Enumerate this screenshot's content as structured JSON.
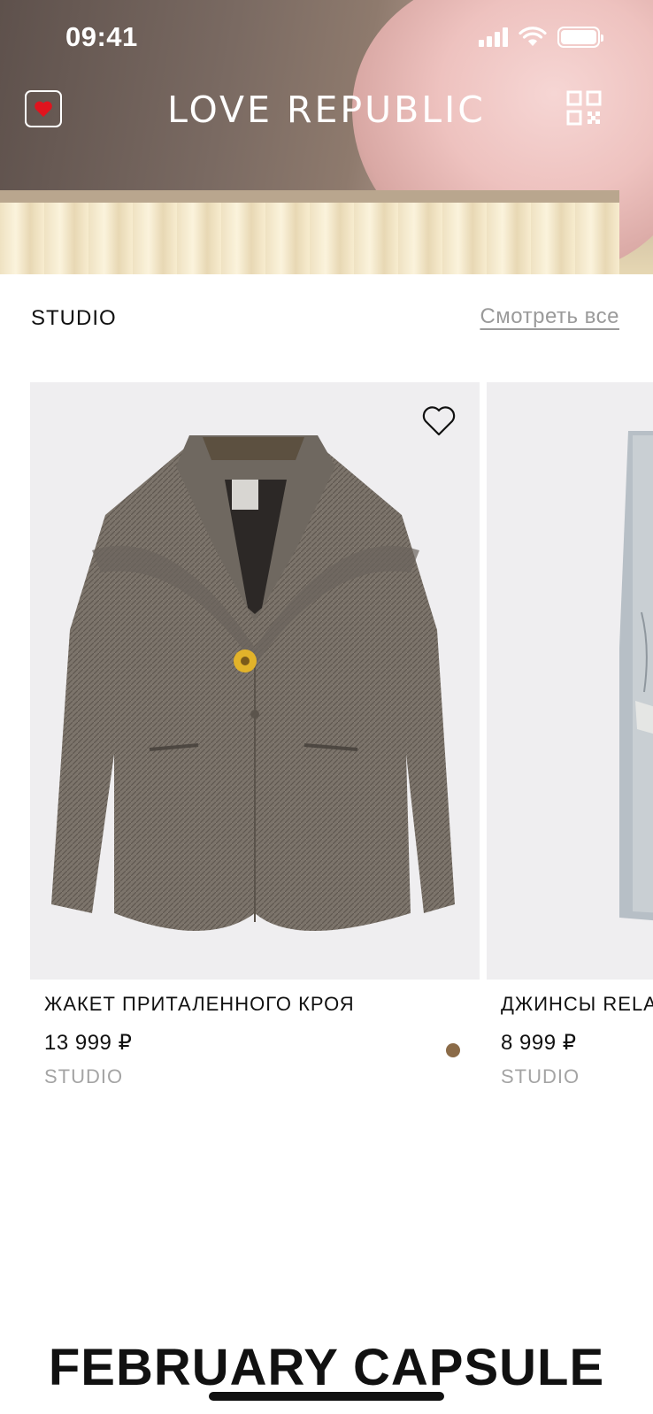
{
  "status_bar": {
    "time": "09:41"
  },
  "header": {
    "brand": "LOVE  REPUBLIC",
    "favorites_icon": "heart-icon",
    "qr_icon": "qr-code-icon"
  },
  "section": {
    "title": "STUDIO",
    "see_all_label": "Смотреть все"
  },
  "products": [
    {
      "name": "ЖАКЕТ ПРИТАЛЕННОГО КРОЯ",
      "price": "13 999 ₽",
      "brand": "STUDIO",
      "swatch_color": "#8b6b48"
    },
    {
      "name": "ДЖИНСЫ RELA",
      "price": "8 999 ₽",
      "brand": "STUDIO"
    }
  ],
  "banner": {
    "title": "FEBRUARY CAPSULE"
  },
  "colors": {
    "accent_heart": "#e0141e",
    "text_muted": "#9a9a9a",
    "card_bg": "#efeef0"
  }
}
